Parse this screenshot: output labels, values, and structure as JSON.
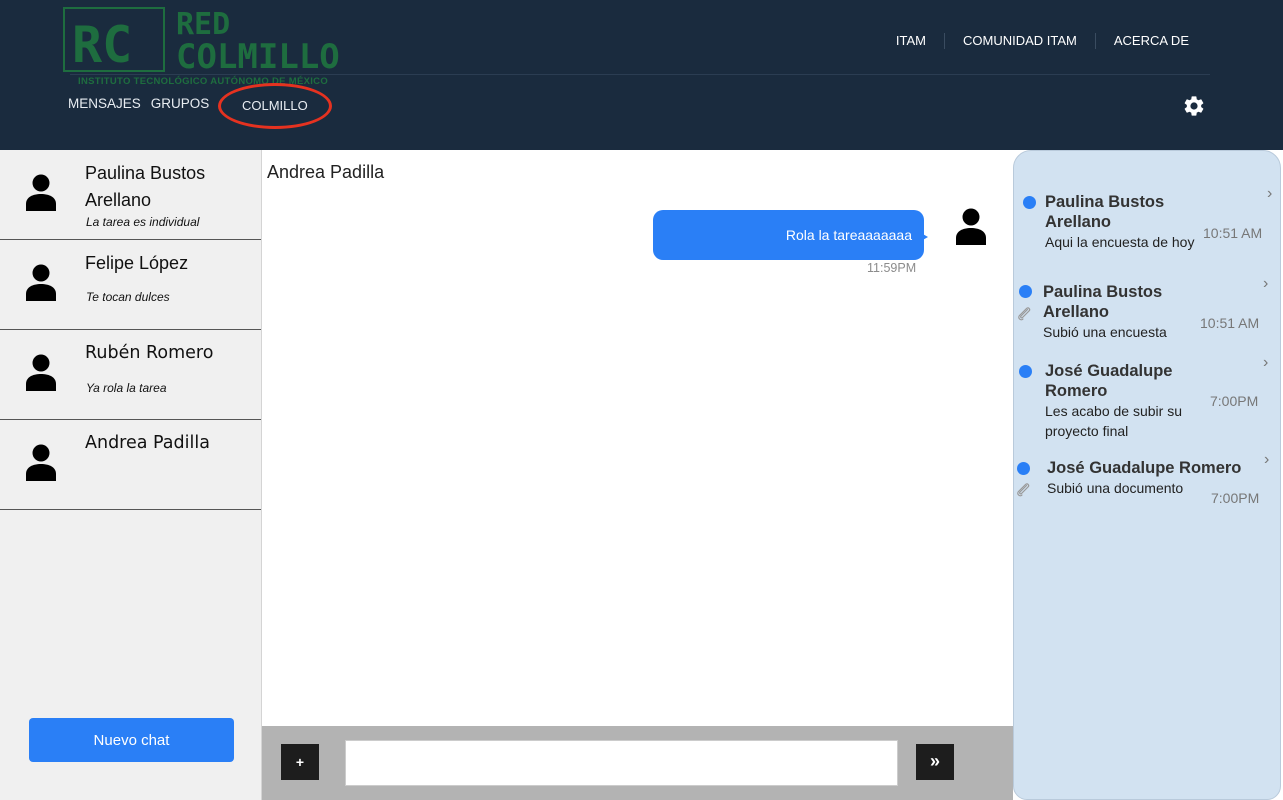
{
  "header": {
    "logo": {
      "initials": "RC",
      "line1": "RED",
      "line2": "COLMILLO",
      "subtitle": "INSTITUTO TECNOLÓGICO AUTÓNOMO DE MÉXICO"
    },
    "top_nav": [
      "ITAM",
      "COMUNIDAD ITAM",
      "ACERCA DE"
    ],
    "sub_nav": [
      "MENSAJES",
      "GRUPOS"
    ],
    "colmillo_link": "COLMILLO",
    "settings_icon": "gear-icon",
    "colors": {
      "background": "#1a2b3e",
      "highlight_ring": "#e53220",
      "logo_green": "#1e6d3f"
    }
  },
  "chat_list": {
    "chats": [
      {
        "name": "Paulina Bustos Arellano",
        "preview": "La tarea es individual"
      },
      {
        "name": "Felipe López",
        "preview": "Te tocan dulces"
      },
      {
        "name": "Rubén Romero",
        "preview": "Ya rola la tarea"
      },
      {
        "name": "Andrea Padilla",
        "preview": ""
      }
    ],
    "new_chat_label": "Nuevo chat"
  },
  "conversation": {
    "title": "Andrea Padilla",
    "messages": [
      {
        "text": "Rola la tareaaaaaaa",
        "time": "11:59PM"
      }
    ],
    "attach_label": "+",
    "send_label": "»",
    "input_value": ""
  },
  "notifications": [
    {
      "name": "Paulina Bustos Arellano",
      "text": "Aqui la encuesta de hoy",
      "time": "10:51 AM",
      "attachment": false
    },
    {
      "name": "Paulina Bustos Arellano",
      "text": "Subió una encuesta",
      "time": "10:51 AM",
      "attachment": true
    },
    {
      "name": "José Guadalupe Romero",
      "text": "Les acabo de subir su proyecto final",
      "time": "7:00PM",
      "attachment": false
    },
    {
      "name": "José Guadalupe Romero",
      "text": "Subió una documento",
      "time": "7:00PM",
      "attachment": true
    }
  ],
  "accent_color": "#2a7ff6"
}
